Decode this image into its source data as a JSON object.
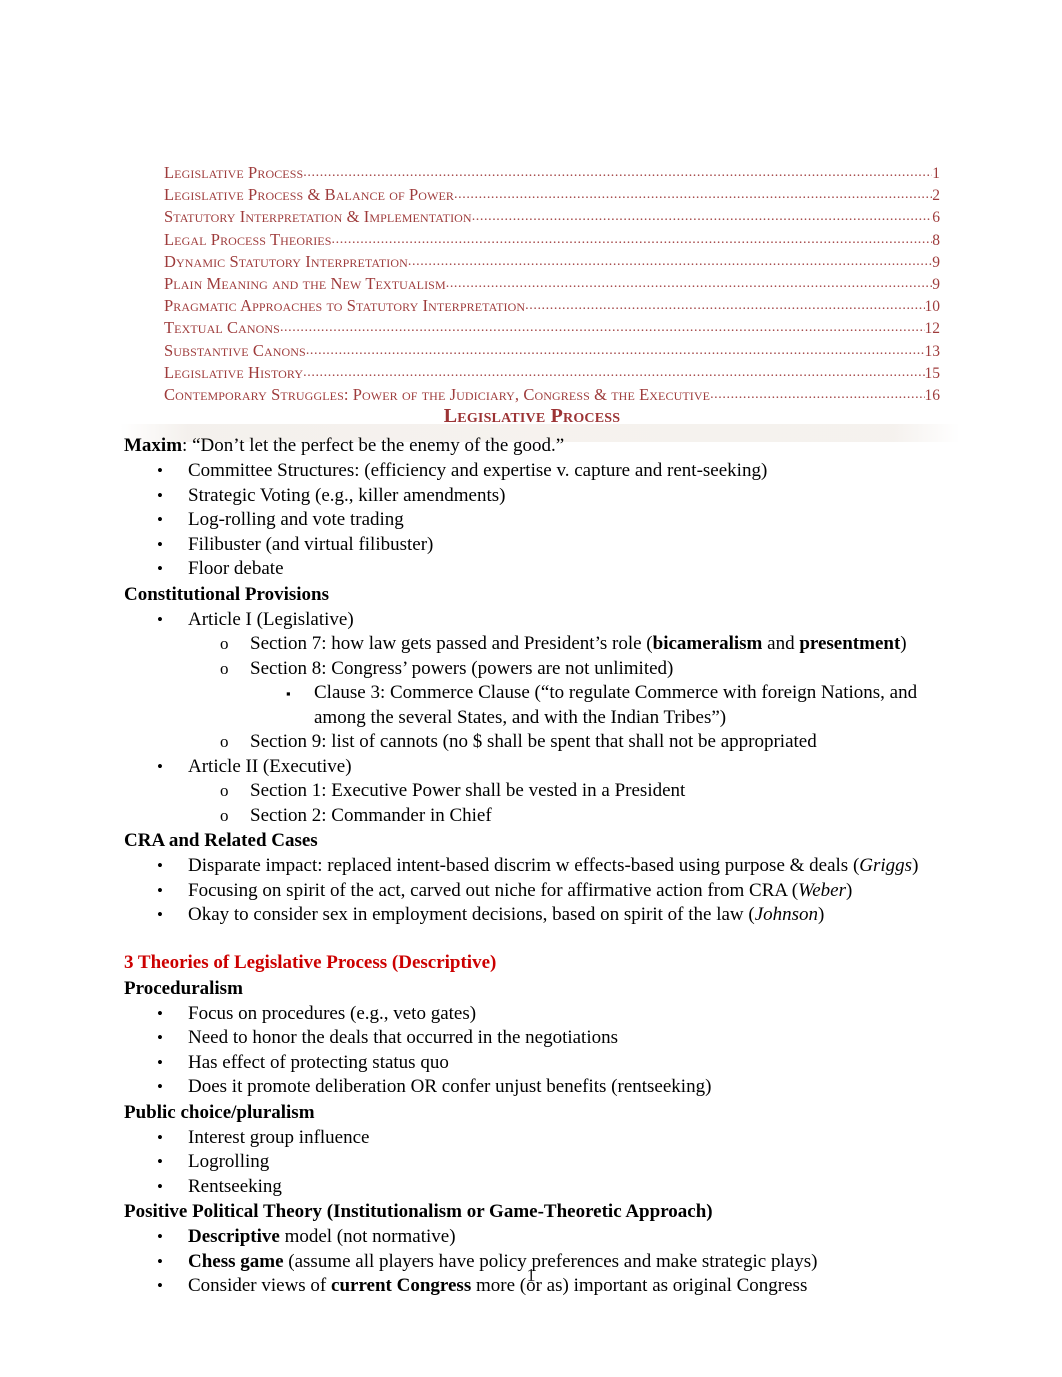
{
  "document": {
    "page_number": "1",
    "colors": {
      "toc_red": "#9e3b3b",
      "heading_red": "#9c3334",
      "accent_red": "#cc0000",
      "body_black": "#000000",
      "page_background": "#ffffff"
    }
  },
  "toc": {
    "entries": [
      {
        "title": "Legislative Process",
        "page": "1"
      },
      {
        "title": "Legislative Process & Balance of Power",
        "page": "2"
      },
      {
        "title": "Statutory Interpretation & Implementation",
        "page": "6"
      },
      {
        "title": "Legal Process Theories",
        "page": "8"
      },
      {
        "title": "Dynamic Statutory Interpretation",
        "page": "9"
      },
      {
        "title": "Plain Meaning and the New Textualism",
        "page": "9"
      },
      {
        "title": "Pragmatic Approaches to Statutory Interpretation",
        "page": "10"
      },
      {
        "title": "Textual Canons",
        "page": "12"
      },
      {
        "title": "Substantive Canons",
        "page": "13"
      },
      {
        "title": "Legislative History",
        "page": "15"
      },
      {
        "title": "Contemporary Struggles: Power of the Judiciary, Congress & the Executive",
        "page": "16"
      }
    ],
    "leader": "......................................................................................................................................................................................................"
  },
  "heading": {
    "title": "Legislative Process"
  },
  "body": {
    "maxim_label": "Maxim",
    "maxim_text": ": “Don’t let the perfect be the enemy of the good.”",
    "maxim_bullets": [
      "Committee Structures: (efficiency and expertise v. capture and rent-seeking)",
      "Strategic Voting (e.g., killer amendments)",
      "Log-rolling and vote trading",
      "Filibuster (and virtual filibuster)",
      "Floor debate"
    ],
    "constitutional_heading": "Constitutional Provisions",
    "article_1": "Article I (Legislative)",
    "section_7_a": "Section 7: how law gets passed and President’s role (",
    "section_7_b": "bicameralism",
    "section_7_c": " and ",
    "section_7_d": "presentment",
    "section_7_e": ")",
    "section_8": "Section 8: Congress’ powers (powers are not unlimited)",
    "clause_3": "Clause 3: Commerce Clause (“to regulate Commerce with foreign Nations, and among the several States, and with the Indian Tribes”)",
    "section_9": "Section 9: list of cannots (no $ shall be spent that shall not be appropriated",
    "article_2": "Article II (Executive)",
    "section_1": "Section 1: Executive Power shall be vested in a President",
    "section_2": "Section 2: Commander in Chief",
    "cra_heading": "CRA and Related Cases",
    "cra_bullets": [
      {
        "text": "Disparate impact: replaced intent-based discrim w effects-based using purpose & deals (",
        "case": "Griggs",
        "tail": ")"
      },
      {
        "text": "Focusing on spirit of the act, carved out niche for affirmative action from CRA (",
        "case": "Weber",
        "tail": ")"
      },
      {
        "text": "Okay to consider sex in employment decisions, based on spirit of the law (",
        "case": "Johnson",
        "tail": ")"
      }
    ],
    "theories_heading": "3 Theories of Legislative Process (Descriptive)",
    "proceduralism_heading": "Proceduralism",
    "proceduralism_bullets": [
      "Focus on procedures (e.g., veto gates)",
      "Need to honor the deals that occurred in the negotiations",
      "Has effect of protecting status quo",
      "Does it promote deliberation OR confer unjust benefits (rentseeking)"
    ],
    "public_choice_heading": "Public choice/pluralism",
    "public_choice_bullets": [
      "Interest group influence",
      "Logrolling",
      "Rentseeking"
    ],
    "ppt_heading": "Positive Political Theory (Institutionalism or Game-Theoretic Approach)",
    "ppt_bullets": [
      {
        "bold": "Descriptive",
        "rest": " model (not normative)"
      },
      {
        "bold": "Chess game",
        "rest": " (assume all players have policy preferences and make strategic plays)"
      },
      {
        "pre": "Consider views of ",
        "bold": "current Congress",
        "rest": " more (or as) important as original Congress"
      }
    ]
  },
  "markers": {
    "level1": "•",
    "level2": "o",
    "level3": "▪"
  }
}
